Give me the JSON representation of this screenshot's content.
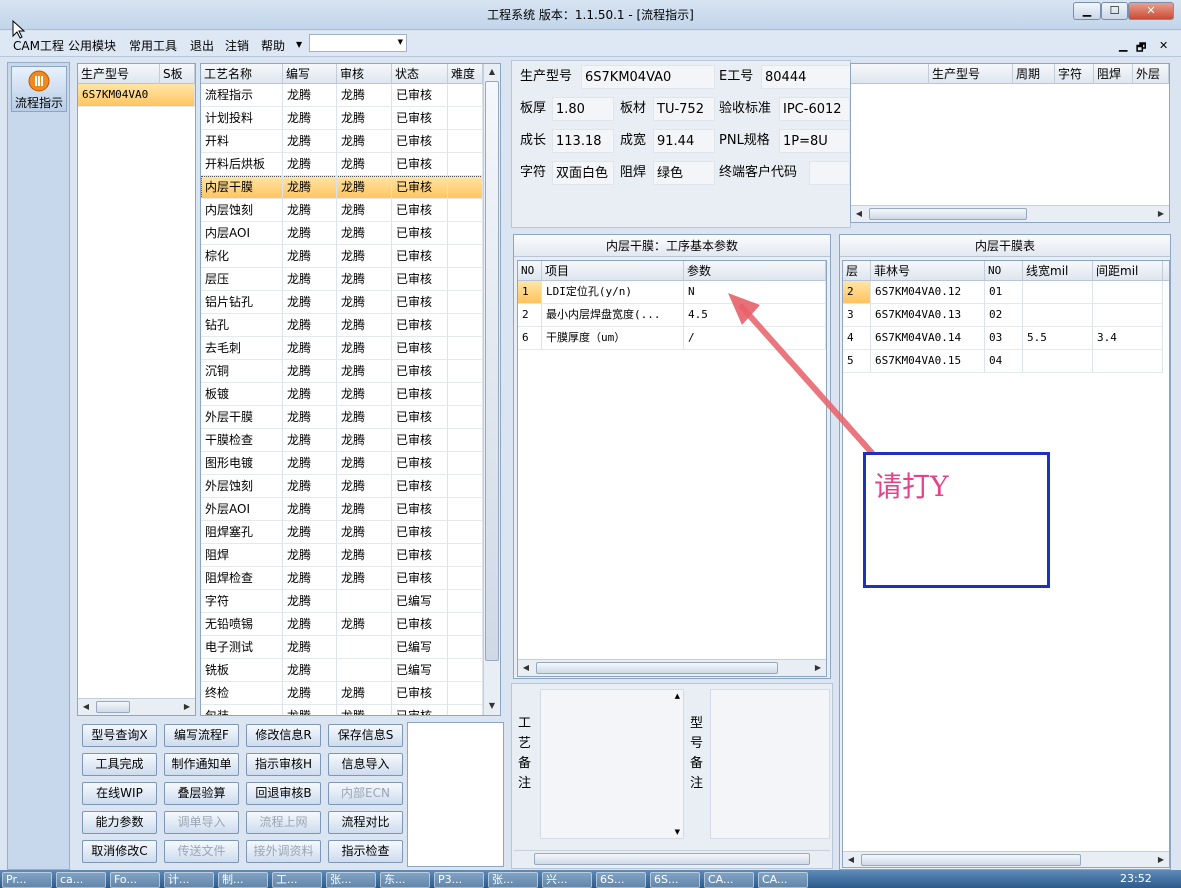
{
  "window": {
    "title": "工程系统  版本：1.1.50.1 - [流程指示]",
    "min": "▁",
    "max": "☐",
    "close": "✕"
  },
  "menu": {
    "items": [
      "CAM工程",
      "公用模块",
      "常用工具",
      "退出",
      "注销",
      "帮助"
    ],
    "combo_value": ""
  },
  "mdi": {
    "min": "▁",
    "restore": "🗗",
    "close": "✕"
  },
  "nav": {
    "label": "流程指示"
  },
  "model_list": {
    "headers": [
      "生产型号",
      "S板"
    ],
    "rows": [
      [
        "6S7KM04VA0",
        ""
      ]
    ]
  },
  "process": {
    "headers": [
      "工艺名称",
      "编写",
      "审核",
      "状态",
      "难度"
    ],
    "rows": [
      [
        "流程指示",
        "龙腾",
        "龙腾",
        "已审核",
        ""
      ],
      [
        "计划投料",
        "龙腾",
        "龙腾",
        "已审核",
        ""
      ],
      [
        "开料",
        "龙腾",
        "龙腾",
        "已审核",
        ""
      ],
      [
        "开料后烘板",
        "龙腾",
        "龙腾",
        "已审核",
        ""
      ],
      [
        "内层干膜",
        "龙腾",
        "龙腾",
        "已审核",
        ""
      ],
      [
        "内层蚀刻",
        "龙腾",
        "龙腾",
        "已审核",
        ""
      ],
      [
        "内层AOI",
        "龙腾",
        "龙腾",
        "已审核",
        ""
      ],
      [
        "棕化",
        "龙腾",
        "龙腾",
        "已审核",
        ""
      ],
      [
        "层压",
        "龙腾",
        "龙腾",
        "已审核",
        ""
      ],
      [
        "铝片钻孔",
        "龙腾",
        "龙腾",
        "已审核",
        ""
      ],
      [
        "钻孔",
        "龙腾",
        "龙腾",
        "已审核",
        ""
      ],
      [
        "去毛刺",
        "龙腾",
        "龙腾",
        "已审核",
        ""
      ],
      [
        "沉铜",
        "龙腾",
        "龙腾",
        "已审核",
        ""
      ],
      [
        "板镀",
        "龙腾",
        "龙腾",
        "已审核",
        ""
      ],
      [
        "外层干膜",
        "龙腾",
        "龙腾",
        "已审核",
        ""
      ],
      [
        "干膜检查",
        "龙腾",
        "龙腾",
        "已审核",
        ""
      ],
      [
        "图形电镀",
        "龙腾",
        "龙腾",
        "已审核",
        ""
      ],
      [
        "外层蚀刻",
        "龙腾",
        "龙腾",
        "已审核",
        ""
      ],
      [
        "外层AOI",
        "龙腾",
        "龙腾",
        "已审核",
        ""
      ],
      [
        "阻焊塞孔",
        "龙腾",
        "龙腾",
        "已审核",
        ""
      ],
      [
        "阻焊",
        "龙腾",
        "龙腾",
        "已审核",
        ""
      ],
      [
        "阻焊检查",
        "龙腾",
        "龙腾",
        "已审核",
        ""
      ],
      [
        "字符",
        "龙腾",
        "",
        "已编写",
        ""
      ],
      [
        "无铅喷锡",
        "龙腾",
        "龙腾",
        "已审核",
        ""
      ],
      [
        "电子测试",
        "龙腾",
        "",
        "已编写",
        ""
      ],
      [
        "铣板",
        "龙腾",
        "",
        "已编写",
        ""
      ],
      [
        "终检",
        "龙腾",
        "龙腾",
        "已审核",
        ""
      ],
      [
        "包装",
        "龙腾",
        "龙腾",
        "已审核",
        ""
      ]
    ]
  },
  "buttons": [
    [
      "型号查询X",
      "编写流程F",
      "修改信息R",
      "保存信息S"
    ],
    [
      "工具完成",
      "制作通知单",
      "指示审核H",
      "信息导入"
    ],
    [
      "在线WIP",
      "叠层验算",
      "回退审核B",
      "内部ECN"
    ],
    [
      "能力参数",
      "调单导入",
      "流程上网",
      "流程对比"
    ],
    [
      "取消修改C",
      "传送文件",
      "接外调资料",
      "指示检查"
    ]
  ],
  "info": {
    "model_label": "生产型号",
    "model": "6S7KM04VA0",
    "eno_label": "E工号",
    "eno": "80444",
    "thick_label": "板厚",
    "thick": "1.80",
    "mat_label": "板材",
    "mat": "TU-752",
    "std_label": "验收标准",
    "std": "IPC-6012",
    "len_label": "成长",
    "len": "113.18",
    "wid_label": "成宽",
    "wid": "91.44",
    "pnl_label": "PNL规格",
    "pnl": "1P=8U",
    "char_label": "字符",
    "char": "双面白色",
    "mask_label": "阻焊",
    "mask": "绿色",
    "cust_label": "终端客户代码",
    "cust": ""
  },
  "right_table": {
    "headers": [
      "生产型号",
      "周期",
      "字符",
      "阻焊",
      "外层"
    ]
  },
  "params": {
    "title": "内层干膜：工序基本参数",
    "headers": [
      "NO",
      "项目",
      "参数"
    ],
    "rows": [
      [
        "1",
        "LDI定位孔(y/n)",
        "N"
      ],
      [
        "2",
        "最小内层焊盘宽度(...",
        "4.5"
      ],
      [
        "6",
        "干膜厚度（um）",
        "/"
      ]
    ]
  },
  "film": {
    "title": "内层干膜表",
    "headers": [
      "层",
      "菲林号",
      "NO",
      "线宽mil",
      "间距mil"
    ],
    "rows": [
      [
        "2",
        "6S7KM04VA0.12",
        "01",
        "",
        ""
      ],
      [
        "3",
        "6S7KM04VA0.13",
        "02",
        "",
        ""
      ],
      [
        "4",
        "6S7KM04VA0.14",
        "03",
        "5.5",
        "3.4"
      ],
      [
        "5",
        "6S7KM04VA0.15",
        "04",
        "",
        ""
      ]
    ]
  },
  "notes": {
    "process_label": "工艺备注",
    "model_label": "型号备注"
  },
  "annotation": {
    "text": "请打Y",
    "color": "#e0458a",
    "border": "#1f2fbf"
  },
  "taskbar": {
    "items": [
      "Pr...",
      "ca...",
      "Fo...",
      "计...",
      "制...",
      "工...",
      "张...",
      "东...",
      "P3...",
      "张...",
      "兴...",
      "6S...",
      "6S...",
      "CA...",
      "CA..."
    ],
    "time": "23:52"
  }
}
